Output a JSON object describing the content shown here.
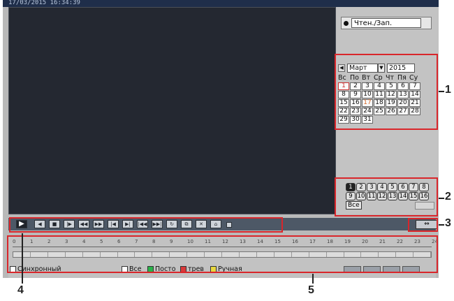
{
  "timestamp": "17/03/2015 16:34:39",
  "mode": {
    "label": "Чтен./Зап."
  },
  "calendar": {
    "month": "Март",
    "year": "2015",
    "weekdays": [
      "Вс",
      "По",
      "Вт",
      "Ср",
      "Чт",
      "Пя",
      "Су"
    ],
    "weeks": [
      [
        "1",
        "2",
        "3",
        "4",
        "5",
        "6",
        "7"
      ],
      [
        "8",
        "9",
        "10",
        "11",
        "12",
        "13",
        "14"
      ],
      [
        "15",
        "16",
        "17",
        "18",
        "19",
        "20",
        "21"
      ],
      [
        "22",
        "23",
        "24",
        "25",
        "26",
        "27",
        "28"
      ],
      [
        "29",
        "30",
        "31",
        "",
        "",
        "",
        ""
      ]
    ],
    "today": "17"
  },
  "channels": {
    "row1": [
      "1",
      "2",
      "3",
      "4",
      "5",
      "6",
      "7",
      "8"
    ],
    "row2": [
      "9",
      "10",
      "11",
      "12",
      "13",
      "14",
      "15",
      "16"
    ],
    "all_label": "Все"
  },
  "controls": {
    "play_icon": "play-icon",
    "icons": [
      "step-back-icon",
      "stop-icon",
      "step-forward-icon",
      "rewind-icon",
      "fast-forward-icon",
      "prev-file-icon",
      "next-file-icon",
      "slow-icon",
      "fast-icon",
      "refresh-icon",
      "snapshot-icon",
      "cut-icon",
      "save-icon"
    ]
  },
  "timeline": {
    "hours": [
      "0",
      "1",
      "2",
      "3",
      "4",
      "5",
      "6",
      "7",
      "8",
      "9",
      "10",
      "11",
      "12",
      "13",
      "14",
      "15",
      "16",
      "17",
      "18",
      "19",
      "20",
      "21",
      "22",
      "23",
      "24"
    ]
  },
  "legend": {
    "sync": "Синхронный",
    "all": "Все",
    "regular": "Посто",
    "alarm": "трев",
    "manual": "Ручная"
  },
  "colors": {
    "annotation": "#d9262b",
    "regular": "#29b34a",
    "alarm": "#d93a3a",
    "manual": "#e8d840"
  },
  "annotations": [
    "1",
    "2",
    "3",
    "4",
    "5"
  ]
}
